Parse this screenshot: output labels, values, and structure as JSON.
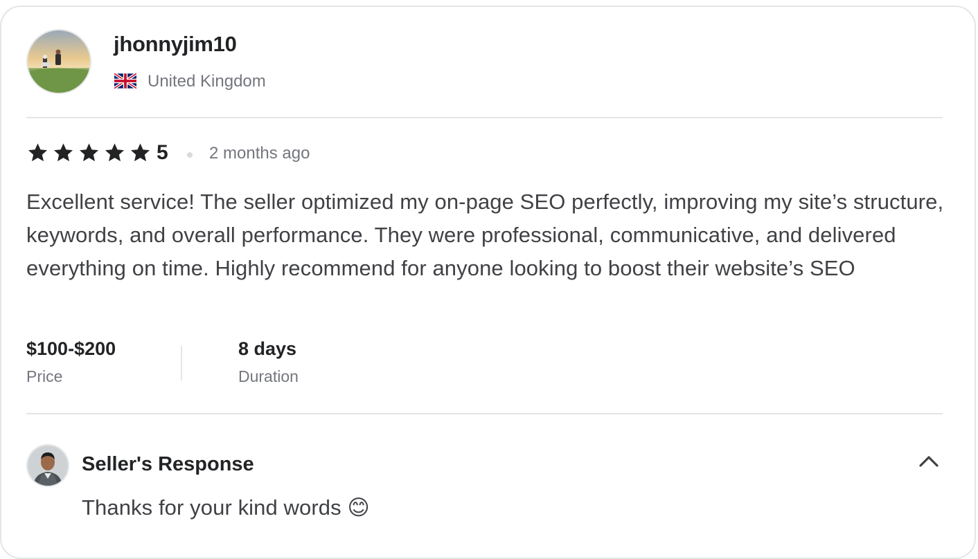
{
  "reviewer": {
    "username": "jhonnyjim10",
    "country": "United Kingdom",
    "avatar_icon": "reviewer-avatar-photo",
    "flag_icon": "uk-flag-icon"
  },
  "review": {
    "rating": "5",
    "rating_value": 5,
    "rating_max": 5,
    "time_ago": "2 months ago",
    "text": "Excellent service! The seller optimized my on-page SEO perfectly, improving my site’s structure, keywords, and overall performance. They were professional, communicative, and delivered everything on time. Highly recommend for anyone looking to boost their website’s SEO",
    "price": {
      "value": "$100-$200",
      "label": "Price"
    },
    "duration": {
      "value": "8 days",
      "label": "Duration"
    }
  },
  "seller_response": {
    "title": "Seller's Response",
    "text": "Thanks for your kind words 😊",
    "avatar_icon": "seller-avatar-photo",
    "toggle_icon": "chevron-up-icon"
  },
  "colors": {
    "text_dark": "#222325",
    "text_body": "#404145",
    "text_muted": "#74767e",
    "border": "#e4e5e7",
    "star": "#222325"
  }
}
